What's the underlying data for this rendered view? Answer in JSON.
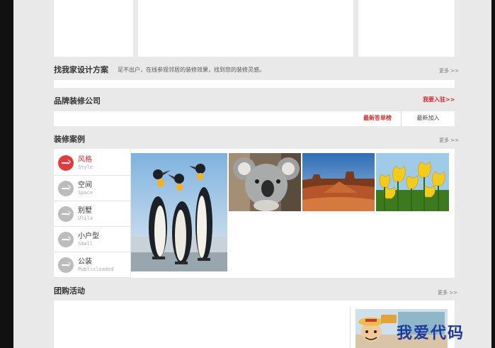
{
  "design": {
    "title": "找我家设计方案",
    "desc": "足不出户，在线参观邻居的装修效果，找到您的装修灵感。",
    "more": "更多"
  },
  "brand": {
    "title": "品牌装修公司",
    "join": "我要入驻",
    "tabs": [
      "最新答单榜",
      "最新加入"
    ]
  },
  "cases": {
    "title": "装修案例",
    "more": "更多",
    "menu": [
      {
        "zh": "风格",
        "en": "Style"
      },
      {
        "zh": "空间",
        "en": "Space"
      },
      {
        "zh": "别墅",
        "en": "Ulila"
      },
      {
        "zh": "小户型",
        "en": "Small"
      },
      {
        "zh": "公装",
        "en": "Publicloaded"
      }
    ],
    "photos": [
      "penguins",
      "koala",
      "desert",
      "tulips"
    ]
  },
  "group": {
    "title": "团购活动",
    "more": "更多"
  },
  "watermark": "我爱代码",
  "colors": {
    "accent": "#d62a2a",
    "background": "#e9e9e9"
  }
}
